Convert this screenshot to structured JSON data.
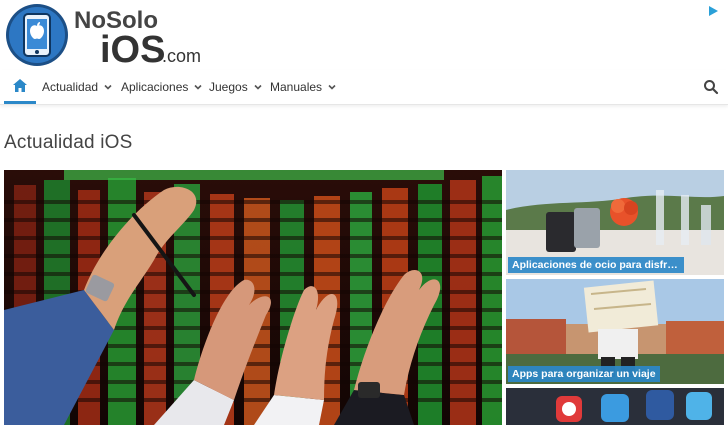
{
  "brand": {
    "name_top": "NoSolo",
    "name_main": "iOS",
    "name_suffix": ".com"
  },
  "nav": {
    "items": [
      {
        "label": "Actualidad",
        "icon": "chevron-down-icon"
      },
      {
        "label": "Aplicaciones",
        "icon": "chevron-down-icon"
      },
      {
        "label": "Juegos",
        "icon": "chevron-down-icon"
      },
      {
        "label": "Manuales",
        "icon": "chevron-down-icon"
      }
    ],
    "home_icon": "home-icon",
    "search_icon": "search-icon"
  },
  "section": {
    "title": "Actualidad iOS"
  },
  "cards": [
    {
      "caption": "Aplicaciones de ocio para disfrutar de..."
    },
    {
      "caption": "Apps para organizar un viaje"
    },
    {
      "caption": ""
    }
  ],
  "colors": {
    "accent": "#2b88c8",
    "text": "#333333"
  }
}
